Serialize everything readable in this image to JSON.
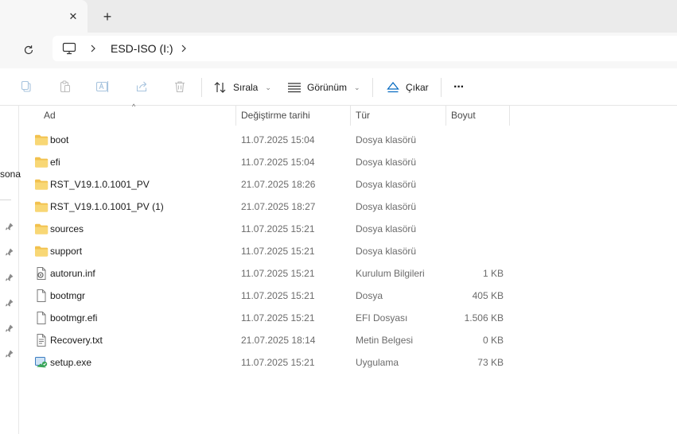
{
  "tabs": {
    "close_symbol": "✕",
    "new_tab_symbol": "+"
  },
  "address": {
    "location": "ESD-ISO (I:)"
  },
  "commands": {
    "sort_label": "Sırala",
    "view_label": "Görünüm",
    "eject_label": "Çıkar",
    "more_label": "···"
  },
  "nav": {
    "partial_item": "sona"
  },
  "columns": {
    "name": "Ad",
    "modified": "Değiştirme tarihi",
    "type": "Tür",
    "size": "Boyut"
  },
  "files": [
    {
      "name": "boot",
      "modified": "11.07.2025 15:04",
      "type": "Dosya klasörü",
      "size": "",
      "icon": "folder-icon"
    },
    {
      "name": "efi",
      "modified": "11.07.2025 15:04",
      "type": "Dosya klasörü",
      "size": "",
      "icon": "folder-icon"
    },
    {
      "name": "RST_V19.1.0.1001_PV",
      "modified": "21.07.2025 18:26",
      "type": "Dosya klasörü",
      "size": "",
      "icon": "folder-icon"
    },
    {
      "name": "RST_V19.1.0.1001_PV (1)",
      "modified": "21.07.2025 18:27",
      "type": "Dosya klasörü",
      "size": "",
      "icon": "folder-icon"
    },
    {
      "name": "sources",
      "modified": "11.07.2025 15:21",
      "type": "Dosya klasörü",
      "size": "",
      "icon": "folder-icon"
    },
    {
      "name": "support",
      "modified": "11.07.2025 15:21",
      "type": "Dosya klasörü",
      "size": "",
      "icon": "folder-icon"
    },
    {
      "name": "autorun.inf",
      "modified": "11.07.2025 15:21",
      "type": "Kurulum Bilgileri",
      "size": "1 KB",
      "icon": "setup-info-file-icon"
    },
    {
      "name": "bootmgr",
      "modified": "11.07.2025 15:21",
      "type": "Dosya",
      "size": "405 KB",
      "icon": "file-icon"
    },
    {
      "name": "bootmgr.efi",
      "modified": "11.07.2025 15:21",
      "type": "EFI Dosyası",
      "size": "1.506 KB",
      "icon": "file-icon"
    },
    {
      "name": "Recovery.txt",
      "modified": "21.07.2025 18:14",
      "type": "Metin Belgesi",
      "size": "0 KB",
      "icon": "text-file-icon"
    },
    {
      "name": "setup.exe",
      "modified": "11.07.2025 15:21",
      "type": "Uygulama",
      "size": "73 KB",
      "icon": "setup-exe-icon"
    }
  ],
  "colors": {
    "folder": "#f2c14e",
    "accent": "#0067c0",
    "text_secondary": "#6b6b6b"
  }
}
